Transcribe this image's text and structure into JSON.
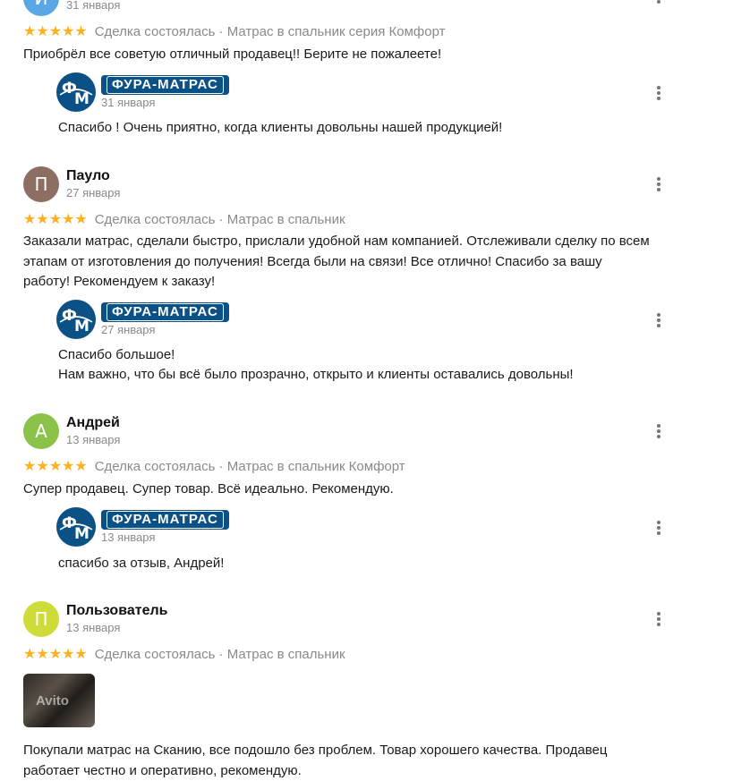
{
  "colors": {
    "star": "#ffb021",
    "brand": "#0b5185",
    "muted": "#8a8a8a"
  },
  "brand_name": "ФУРА-МАТРАС",
  "reviews": [
    {
      "avatar_letter": "И",
      "avatar_color": "#5aa7e6",
      "author": "",
      "date": "31 января",
      "stars": "★★★★★",
      "deal": "Сделка состоялась · Матрас в спальник серия Комфорт",
      "text": "Приобрёл все советую отличный продавец!! Берите не пожалеете!",
      "reply": {
        "date": "31 января",
        "text": "Спасибо ! Очень приятно, когда клиенты довольны нашей продукцией!"
      }
    },
    {
      "avatar_letter": "П",
      "avatar_color": "#8d6e63",
      "author": "Пауло",
      "date": "27 января",
      "stars": "★★★★★",
      "deal": "Сделка состоялась · Матрас в спальник",
      "text_lines": [
        "Заказали матрас, сделали быстро, прислали удобной нам компанией. Отслеживали сделку по всем",
        "этапам от изготовления до получения! Всегда были на связи! Все отлично! Спасибо за вашу",
        "работу! Рекомендуем к заказу!"
      ],
      "reply": {
        "date": "27 января",
        "text_lines": [
          "Спасибо большое!",
          "Нам важно, что бы всё было прозрачно, открыто и клиенты оставались довольны!"
        ]
      }
    },
    {
      "avatar_letter": "А",
      "avatar_color": "#8bc34a",
      "author": "Андрей",
      "date": "13 января",
      "stars": "★★★★★",
      "deal": "Сделка состоялась · Матрас в спальник Комфорт",
      "text": "Супер продавец. Супер товар. Всё идеально. Рекомендую.",
      "reply": {
        "date": "13 января",
        "text": "спасибо за отзыв, Андрей!"
      }
    },
    {
      "avatar_letter": "П",
      "avatar_color": "#cddc39",
      "author": "Пользователь",
      "date": "13 января",
      "stars": "★★★★★",
      "deal": "Сделка состоялась · Матрас в спальник",
      "photo_watermark": "Avito",
      "text_lines": [
        "Покупали матрас на Сканию, все подошло без проблем. Товар хорошего качества. Продавец",
        "работает честно и оперативно, рекомендую."
      ]
    }
  ]
}
